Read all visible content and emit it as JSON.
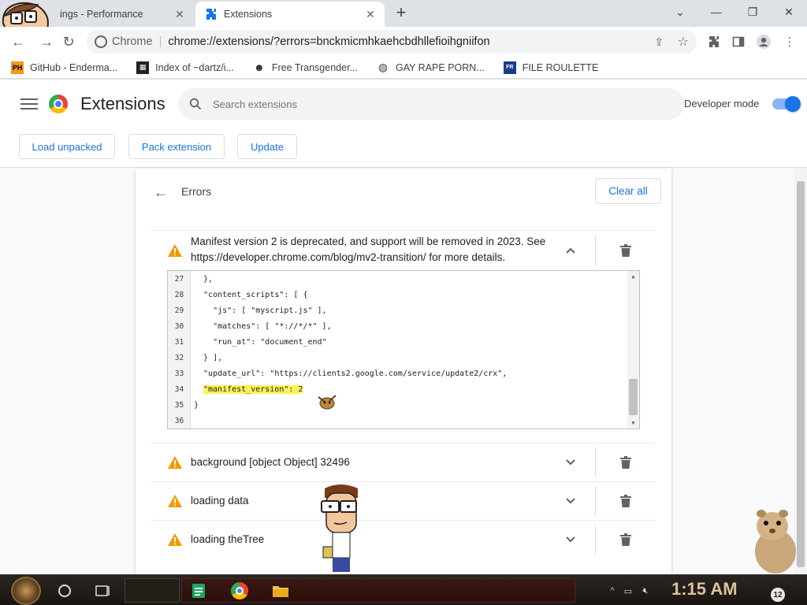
{
  "tabs": [
    {
      "title": "Settings - Performance",
      "visible_title": "ings - Performance",
      "active": false
    },
    {
      "title": "Extensions",
      "active": true
    }
  ],
  "omnibox": {
    "site_label": "Chrome",
    "url": "chrome://extensions/?errors=bnckmicmhkaehcbdhllefioihgniifon"
  },
  "bookmarks": [
    {
      "label": "GitHub - Enderma...",
      "icon": "ph-icon"
    },
    {
      "label": "Index of ~dartz/i...",
      "icon": "folder-pixel-icon"
    },
    {
      "label": "Free Transgender...",
      "icon": "mask-icon"
    },
    {
      "label": "GAY RAPE PORN...",
      "icon": "globe-icon"
    },
    {
      "label": "FILE ROULETTE",
      "icon": "roulette-icon"
    }
  ],
  "header": {
    "title": "Extensions",
    "search_placeholder": "Search extensions",
    "developer_mode_label": "Developer mode",
    "developer_mode_on": true
  },
  "actions": {
    "load_unpacked": "Load unpacked",
    "pack_extension": "Pack extension",
    "update": "Update"
  },
  "errors_panel": {
    "title": "Errors",
    "clear_all": "Clear all",
    "items": [
      {
        "message_line1": "Manifest version 2 is deprecated, and support will be removed in 2023. See",
        "message_line2": "https://developer.chrome.com/blog/mv2-transition/ for more details.",
        "expanded": true
      },
      {
        "message_line1": "background [object Object] 32496",
        "expanded": false
      },
      {
        "message_line1": "loading data",
        "expanded": false
      },
      {
        "message_line1": "loading theTree",
        "expanded": false
      }
    ]
  },
  "code_view": {
    "lines": [
      {
        "n": "27",
        "text": "  },"
      },
      {
        "n": "28",
        "text": "  \"content_scripts\": [ {"
      },
      {
        "n": "29",
        "text": "    \"js\": [ \"myscript.js\" ],"
      },
      {
        "n": "30",
        "text": "    \"matches\": [ \"*://*/*\" ],"
      },
      {
        "n": "31",
        "text": "    \"run_at\": \"document_end\""
      },
      {
        "n": "32",
        "text": "  } ],"
      },
      {
        "n": "33",
        "text": "  \"update_url\": \"https://clients2.google.com/service/update2/crx\","
      },
      {
        "n": "34",
        "text": "\"manifest_version\": 2",
        "highlight": true
      },
      {
        "n": "35",
        "text": "}"
      },
      {
        "n": "36",
        "text": ""
      }
    ]
  },
  "taskbar": {
    "clock": "1:15 AM",
    "notification_count": "12"
  },
  "colors": {
    "accent": "#1a73e8",
    "warning": "#f29900",
    "highlight": "#fff15a"
  }
}
